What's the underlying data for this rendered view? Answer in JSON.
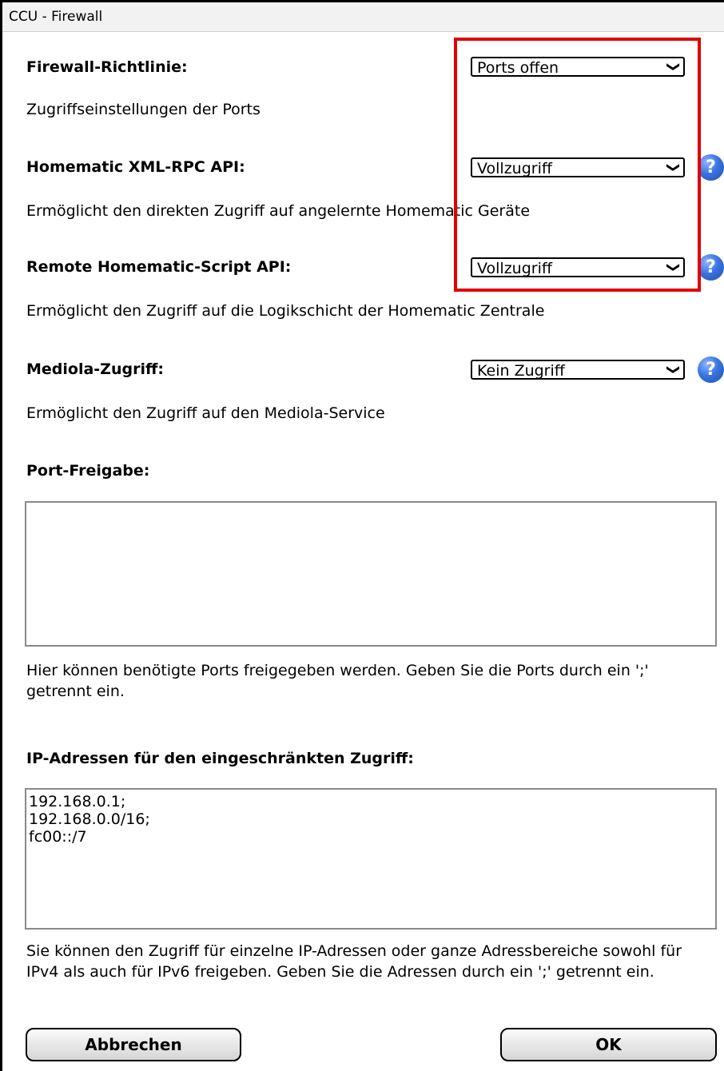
{
  "window": {
    "title": "CCU - Firewall"
  },
  "firewall_policy": {
    "label": "Firewall-Richtlinie:",
    "value": "Ports offen",
    "description": "Zugriffseinstellungen der Ports"
  },
  "xmlrpc_api": {
    "label": "Homematic XML-RPC API:",
    "value": "Vollzugriff",
    "description": "Ermöglicht den direkten Zugriff auf angelernte Homematic Geräte"
  },
  "script_api": {
    "label": "Remote Homematic-Script API:",
    "value": "Vollzugriff",
    "description": "Ermöglicht den Zugriff auf die Logikschicht der Homematic Zentrale"
  },
  "mediola": {
    "label": "Mediola-Zugriff:",
    "value": "Kein Zugriff",
    "description": "Ermöglicht den Zugriff auf den Mediola-Service"
  },
  "port_release": {
    "label": "Port-Freigabe:",
    "value": "",
    "description": "Hier können benötigte Ports freigegeben werden. Geben Sie die Ports durch ein ';' getrennt ein."
  },
  "ip_access": {
    "label": "IP-Adressen für den eingeschränkten Zugriff:",
    "lines": [
      "192.168.0.1;",
      "192.168.0.0/16;",
      "fc00::/7"
    ],
    "description": "Sie können den Zugriff für einzelne IP-Adressen oder ganze Adressbereiche sowohl für IPv4 als auch für IPv6 freigeben. Geben Sie die Adressen durch ein ';' getrennt ein."
  },
  "buttons": {
    "cancel": "Abbrechen",
    "ok": "OK"
  },
  "help_glyph": "?",
  "select_chevron": "❯",
  "colors": {
    "highlight_box": "#e00000",
    "help_icon": "#3a74e0"
  }
}
